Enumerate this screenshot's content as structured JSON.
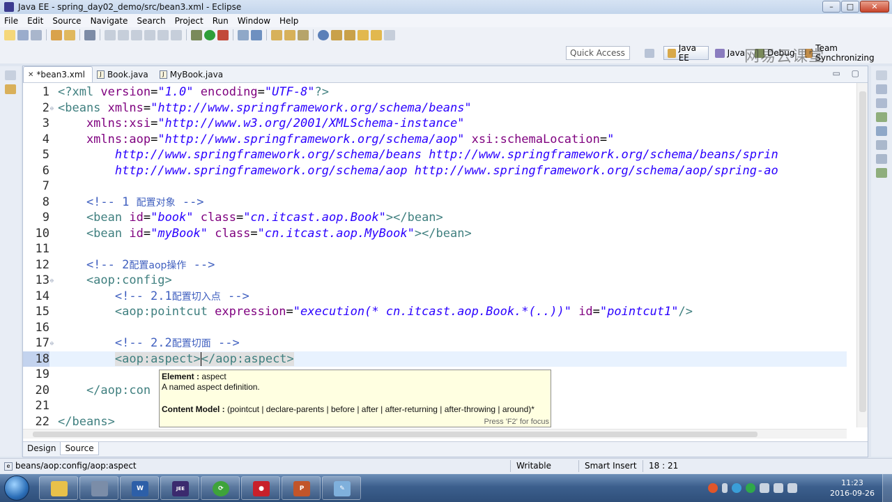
{
  "window": {
    "title": "Java EE - spring_day02_demo/src/bean3.xml - Eclipse",
    "minimize": "–",
    "maximize": "□",
    "close": "✕"
  },
  "menu": [
    "File",
    "Edit",
    "Source",
    "Navigate",
    "Search",
    "Project",
    "Run",
    "Window",
    "Help"
  ],
  "quick_access": {
    "placeholder": "Quick Access"
  },
  "perspectives": [
    {
      "label": "Java EE",
      "active": true
    },
    {
      "label": "Java",
      "active": false
    },
    {
      "label": "Debug",
      "active": false
    },
    {
      "label": "Team Synchronizing",
      "active": false
    }
  ],
  "watermark": "网易云课堂",
  "editor": {
    "tabs": [
      {
        "label": "*bean3.xml",
        "active": true,
        "close": "✕"
      },
      {
        "label": "Book.java",
        "active": false
      },
      {
        "label": "MyBook.java",
        "active": false
      }
    ],
    "tab_controls": "▭ ▢",
    "lines": {
      "1": "1",
      "2": "2",
      "3": "3",
      "4": "4",
      "5": "5",
      "6": "6",
      "7": "7",
      "8": "8",
      "9": "9",
      "10": "10",
      "11": "11",
      "12": "12",
      "13": "13",
      "14": "14",
      "15": "15",
      "16": "16",
      "17": "17",
      "18": "18",
      "19": "19",
      "20": "20",
      "21": "21",
      "22": "22"
    },
    "code": {
      "l1_open": "<?xml ",
      "l1_a1": "version",
      "l1_eq1": "=",
      "l1_v1": "\"1.0\"",
      "l1_a2": " encoding",
      "l1_eq2": "=",
      "l1_v2": "\"UTF-8\"",
      "l1_close": "?>",
      "l2_tag": "<beans ",
      "l2_attr": "xmlns",
      "l2_eq": "=",
      "l2_val": "\"http://www.springframework.org/schema/beans\"",
      "l3_attr": "    xmlns:xsi",
      "l3_eq": "=",
      "l3_val": "\"http://www.w3.org/2001/XMLSchema-instance\"",
      "l4_attr": "    xmlns:aop",
      "l4_eq": "=",
      "l4_val": "\"http://www.springframework.org/schema/aop\"",
      "l4_attr2": " xsi:schemaLocation",
      "l4_eq2": "=",
      "l4_val2": "\"",
      "l5_val": "        http://www.springframework.org/schema/beans http://www.springframework.org/schema/beans/sprin",
      "l6_val": "        http://www.springframework.org/schema/aop http://www.springframework.org/schema/aop/spring-ao",
      "l8_c1": "    <!-- 1 ",
      "l8_cn": "配置对象",
      "l8_c2": " -->",
      "l9_t1": "    <bean ",
      "l9_a1": "id",
      "l9_eq1": "=",
      "l9_v1": "\"book\"",
      "l9_a2": " class",
      "l9_eq2": "=",
      "l9_v2": "\"cn.itcast.aop.Book\"",
      "l9_t2": "></bean>",
      "l10_t1": "    <bean ",
      "l10_a1": "id",
      "l10_eq1": "=",
      "l10_v1": "\"myBook\"",
      "l10_a2": " class",
      "l10_eq2": "=",
      "l10_v2": "\"cn.itcast.aop.MyBook\"",
      "l10_t2": "></bean>",
      "l12_c1": "    <!-- 2",
      "l12_cn": "配置aop操作",
      "l12_c2": " -->",
      "l13_t": "    <aop:config>",
      "l14_c1": "        <!-- 2.1",
      "l14_cn": "配置切入点",
      "l14_c2": " -->",
      "l15_t1": "        <aop:pointcut ",
      "l15_a1": "expression",
      "l15_eq1": "=",
      "l15_v1": "\"execution(* cn.itcast.aop.Book.*(..))\"",
      "l15_a2": " id",
      "l15_eq2": "=",
      "l15_v2": "\"pointcut1\"",
      "l15_t2": "/>",
      "l17_c1": "        <!-- 2.2",
      "l17_cn": "配置切面",
      "l17_c2": " -->",
      "l18_ind": "        ",
      "l18_t1": "<aop:aspect>",
      "l18_t2": "</aop:aspect>",
      "l20_t": "    </aop:con",
      "l22_t": "</beans>"
    },
    "view_tabs": [
      {
        "label": "Design",
        "active": false
      },
      {
        "label": "Source",
        "active": true
      }
    ]
  },
  "tooltip": {
    "element_label": "Element :",
    "element_value": " aspect",
    "description": "A named aspect definition.",
    "content_model_label": "Content Model :",
    "content_model_value": " (pointcut | declare-parents | before | after | after-returning | after-throwing | around)*",
    "footer": "Press 'F2' for focus"
  },
  "statusbar": {
    "path": "beans/aop:config/aop:aspect",
    "mode": "Writable",
    "insert": "Smart Insert",
    "position": "18 : 21"
  },
  "clock": {
    "time": "11:23",
    "date": "2016-09-26"
  },
  "taskbar_apps": [
    {
      "name": "explorer",
      "color": "#e8c14a",
      "glyph": ""
    },
    {
      "name": "monitor",
      "color": "#7b8da8",
      "glyph": ""
    },
    {
      "name": "word",
      "color": "#2d5fa8",
      "glyph": "W"
    },
    {
      "name": "javaee-ide",
      "color": "#3b2a6e",
      "glyph": "JEE"
    },
    {
      "name": "refresh",
      "color": "#3ea33a",
      "glyph": "⟳"
    },
    {
      "name": "record",
      "color": "#c8202a",
      "glyph": "●"
    },
    {
      "name": "powerpoint",
      "color": "#c2552a",
      "glyph": "P"
    },
    {
      "name": "paint",
      "color": "#7fb0dc",
      "glyph": "✎"
    }
  ]
}
